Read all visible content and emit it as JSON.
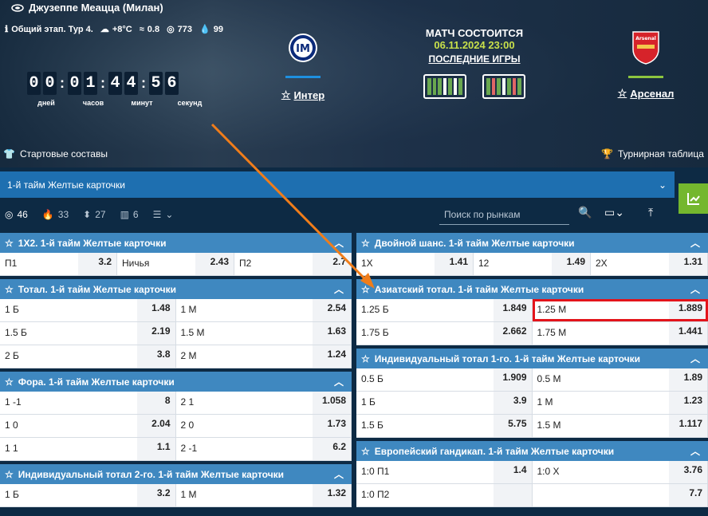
{
  "match": {
    "stadium": "Джузеппе Меацца (Милан)",
    "stage": "Общий этап. Тур 4.",
    "temp": "+8°C",
    "wind": "0.8",
    "pressure": "773",
    "humidity": "99",
    "timer_digits": [
      "0",
      "0",
      "0",
      "1",
      "4",
      "4",
      "5",
      "6"
    ],
    "timer_labels": [
      "дней",
      "часов",
      "минут",
      "секунд"
    ],
    "status": "МАТЧ СОСТОИТСЯ",
    "datetime": "06.11.2024 23:00",
    "recent": "ПОСЛЕДНИЕ ИГРЫ",
    "home": {
      "name": "Интер",
      "bar_color": "#1e90e0"
    },
    "away": {
      "name": "Арсенал",
      "logo_text": "Arsenal",
      "bar_color": "#8dc63f"
    },
    "home_form": [
      "#6aa84f",
      "#6aa84f",
      "#6aa84f",
      "#ffffff",
      "#6aa84f",
      "#ffffff",
      "#6aa84f"
    ],
    "away_form": [
      "#6aa84f",
      "#e06666",
      "#6aa84f",
      "#ffffff",
      "#6aa84f",
      "#e06666",
      "#6aa84f"
    ],
    "lineups": "Стартовые составы",
    "standings": "Турнирная таблица"
  },
  "selector": {
    "label": "1-й тайм Желтые карточки"
  },
  "tabs": [
    {
      "icon": "target-icon",
      "count": "46"
    },
    {
      "icon": "fire-icon",
      "count": "33"
    },
    {
      "icon": "updown-icon",
      "count": "27"
    },
    {
      "icon": "stats-icon",
      "count": "6"
    }
  ],
  "search": {
    "placeholder": "Поиск по рынкам"
  },
  "left_markets": [
    {
      "title": "1Х2. 1-й тайм Желтые карточки",
      "rows": [
        [
          [
            "П1",
            "3.2"
          ],
          [
            "Ничья",
            "2.43"
          ],
          [
            "П2",
            "2.7"
          ]
        ]
      ]
    },
    {
      "title": "Тотал. 1-й тайм Желтые карточки",
      "rows": [
        [
          [
            "1 Б",
            "1.48"
          ],
          [
            "1 М",
            "2.54"
          ]
        ],
        [
          [
            "1.5 Б",
            "2.19"
          ],
          [
            "1.5 М",
            "1.63"
          ]
        ],
        [
          [
            "2 Б",
            "3.8"
          ],
          [
            "2 М",
            "1.24"
          ]
        ]
      ]
    },
    {
      "title": "Фора. 1-й тайм Желтые карточки",
      "rows": [
        [
          [
            "1 -1",
            "8"
          ],
          [
            "2 1",
            "1.058"
          ]
        ],
        [
          [
            "1 0",
            "2.04"
          ],
          [
            "2 0",
            "1.73"
          ]
        ],
        [
          [
            "1 1",
            "1.1"
          ],
          [
            "2 -1",
            "6.2"
          ]
        ]
      ]
    },
    {
      "title": "Индивидуальный тотал 2-го. 1-й тайм Желтые карточки",
      "rows": [
        [
          [
            "1 Б",
            "3.2"
          ],
          [
            "1 М",
            "1.32"
          ]
        ]
      ]
    }
  ],
  "right_markets": [
    {
      "title": "Двойной шанс. 1-й тайм Желтые карточки",
      "rows": [
        [
          [
            "1Х",
            "1.41"
          ],
          [
            "12",
            "1.49"
          ],
          [
            "2Х",
            "1.31"
          ]
        ]
      ]
    },
    {
      "title": "Азиатский тотал. 1-й тайм Желтые карточки",
      "rows": [
        [
          [
            "1.25 Б",
            "1.849"
          ],
          [
            "1.25 М",
            "1.889"
          ]
        ],
        [
          [
            "1.75 Б",
            "2.662"
          ],
          [
            "1.75 М",
            "1.441"
          ]
        ]
      ]
    },
    {
      "title": "Индивидуальный тотал 1-го. 1-й тайм Желтые карточки",
      "rows": [
        [
          [
            "0.5 Б",
            "1.909"
          ],
          [
            "0.5 М",
            "1.89"
          ]
        ],
        [
          [
            "1 Б",
            "3.9"
          ],
          [
            "1 М",
            "1.23"
          ]
        ],
        [
          [
            "1.5 Б",
            "5.75"
          ],
          [
            "1.5 М",
            "1.117"
          ]
        ]
      ]
    },
    {
      "title": "Европейский гандикап. 1-й тайм Желтые карточки",
      "rows": [
        [
          [
            "1:0 П1",
            "1.4"
          ],
          [
            "1:0 Х",
            "3.76"
          ]
        ],
        [
          [
            "1:0 П2",
            ""
          ],
          [
            "",
            "7.7"
          ]
        ]
      ]
    }
  ]
}
